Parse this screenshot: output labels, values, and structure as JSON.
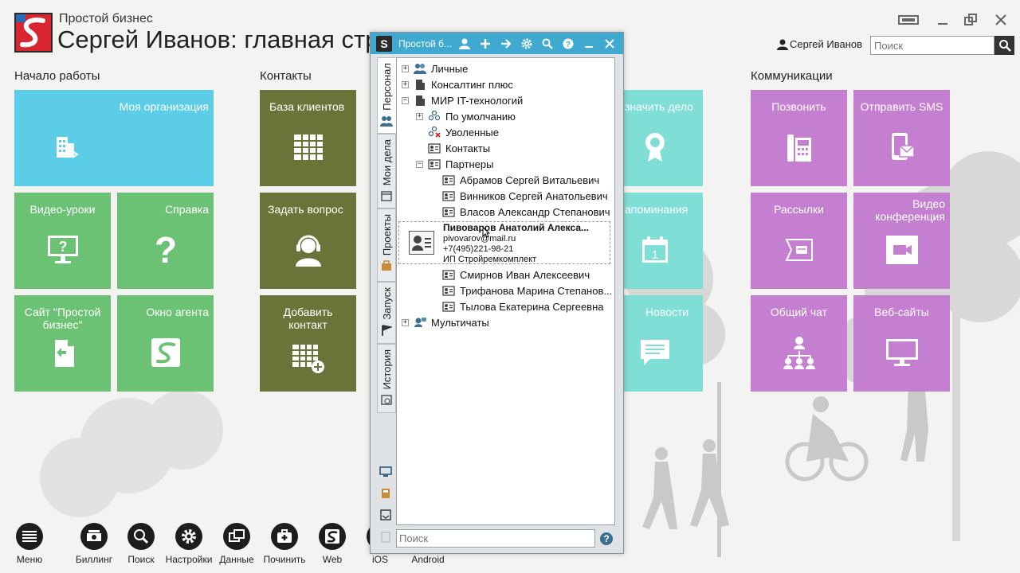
{
  "app": {
    "subtitle": "Простой бизнес",
    "title": "Сергей Иванов: главная страница"
  },
  "header": {
    "user_name": "Сергей Иванов",
    "search_placeholder": "Поиск"
  },
  "sections": {
    "start": "Начало работы",
    "contacts": "Контакты",
    "comms": "Коммуникации"
  },
  "tiles": {
    "my_org": "Моя организация",
    "video_lessons": "Видео-уроки",
    "help": "Справка",
    "site": "Сайт \"Простой бизнес\"",
    "agent": "Окно агента",
    "client_base": "База клиентов",
    "ask_question": "Задать вопрос",
    "add_contact": "Добавить контакт",
    "assign_task": "значить дело",
    "reminders": "апоминания",
    "news": "Новости",
    "call": "Позвонить",
    "sms": "Отправить SMS",
    "mailings": "Рассылки",
    "video_conf": "Видео конференция",
    "chat": "Общий чат",
    "websites": "Веб-сайты"
  },
  "bottom": [
    "Меню",
    "Биллинг",
    "Поиск",
    "Настройки",
    "Данные",
    "Починить",
    "Web",
    "iOS",
    "Android"
  ],
  "popup": {
    "title": "Простой б...",
    "tabs": {
      "personal": "Персонал",
      "my_tasks": "Мои дела",
      "projects": "Проекты",
      "launch": "Запуск",
      "history": "История"
    },
    "tree": {
      "personal": "Личные",
      "consulting": "Консалтинг плюс",
      "mir": "МИР IT-технологий",
      "default": "По умолчанию",
      "fired": "Уволенные",
      "contacts": "Контакты",
      "partners": "Партнеры",
      "p1": "Абрамов Сергей Витальевич",
      "p2": "Винников Сергей Анатольевич",
      "p3": "Власов Александр Степанович",
      "p5": "Смирнов Иван Алексеевич",
      "p6": "Трифанова Марина Степанов...",
      "p7": "Тылова Екатерина Сергеевна",
      "multichat": "Мультичаты"
    },
    "tooltip": {
      "name": "Пивоваров Анатолий Алекса...",
      "email": "pivovarov@mail.ru",
      "phone": "+7(495)221-98-21",
      "company": "ИП Стройремкомплект"
    },
    "search_placeholder": "Поиск",
    "help": "?"
  }
}
